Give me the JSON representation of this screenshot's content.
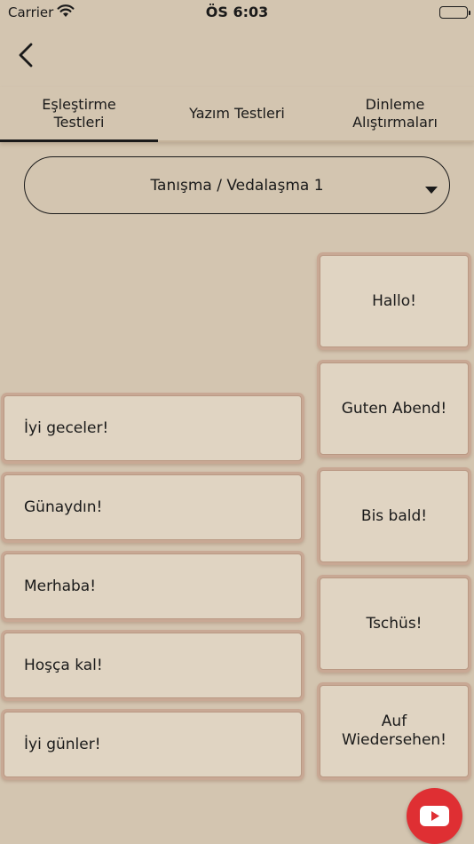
{
  "status_bar": {
    "carrier": "Carrier",
    "time": "ÖS 6:03"
  },
  "tabs": [
    {
      "label": "Eşleştirme\nTestleri",
      "active": true
    },
    {
      "label": "Yazım Testleri",
      "active": false
    },
    {
      "label": "Dinleme\nAlıştırmaları",
      "active": false
    }
  ],
  "dropdown": {
    "selected": "Tanışma / Vedalaşma 1"
  },
  "left_cards": [
    {
      "text": "İyi geceler!"
    },
    {
      "text": "Günaydın!"
    },
    {
      "text": "Merhaba!"
    },
    {
      "text": "Hoşça kal!"
    },
    {
      "text": "İyi günler!"
    }
  ],
  "right_cards": [
    {
      "text": "Hallo!"
    },
    {
      "text": "Guten Abend!"
    },
    {
      "text": "Bis bald!"
    },
    {
      "text": "Tschüs!"
    },
    {
      "text": "Auf\nWiedersehen!"
    }
  ],
  "icons": {
    "back": "chevron-left-icon",
    "dropdown": "caret-down-icon",
    "youtube": "youtube-play-icon"
  },
  "colors": {
    "background": "#d3c5b0",
    "card": "#e0d4c2",
    "card_border": "#c8a894",
    "youtube": "#df2f33"
  }
}
